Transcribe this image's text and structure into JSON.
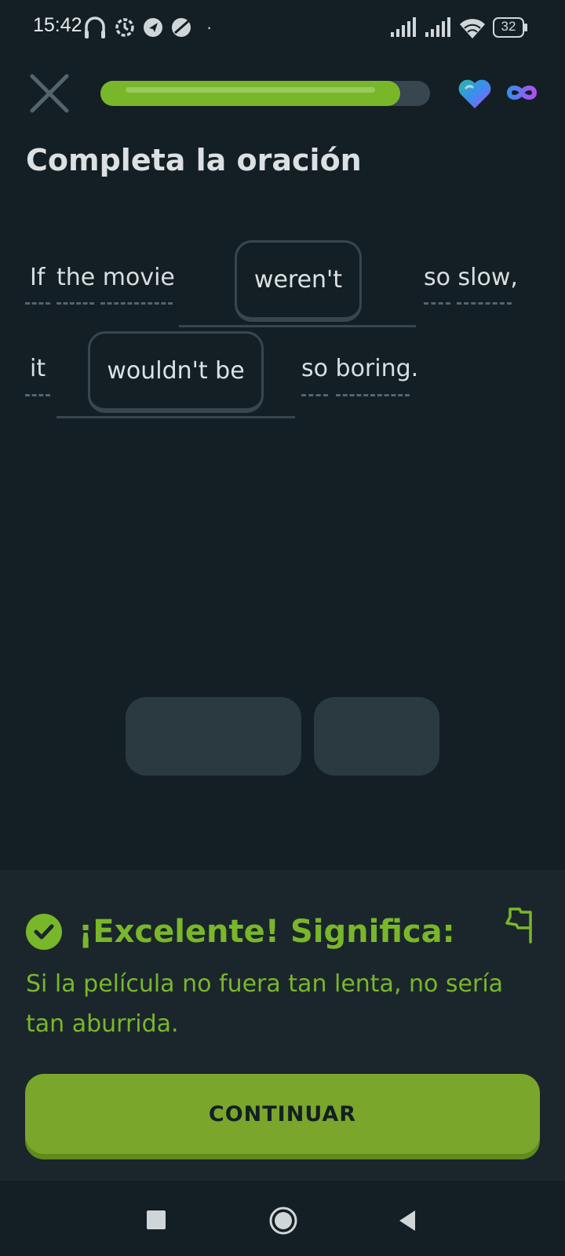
{
  "status_bar": {
    "time": "15:42",
    "dot": "·",
    "battery": "32",
    "icons": [
      "headphones-icon",
      "sync-icon",
      "airplane-icon",
      "app-icon",
      "signal-icon",
      "signal-icon",
      "wifi-icon",
      "battery-icon"
    ]
  },
  "header": {
    "progress": 0.91,
    "close_icon": "close-icon",
    "hearts_icon": "heart-icon",
    "hearts_value_icon": "infinity-icon"
  },
  "exercise": {
    "title": "Completa la oración",
    "line1": {
      "w_if": "If",
      "w_the_movie": "the movie",
      "answer1": "weren't",
      "w_so_slow": "so slow,"
    },
    "line2": {
      "w_it": "it",
      "answer2": "wouldn't be",
      "w_so_boring": "so boring."
    }
  },
  "feedback": {
    "title": "¡Excelente! Significa:",
    "translation": "Si la película no fuera tan lenta, no sería tan aburrida.",
    "continue_label": "CONTINUAR",
    "colors": {
      "accent": "#79b72a",
      "panel": "#1b262c",
      "background": "#131f24"
    }
  },
  "nav": {
    "icons": [
      "recents-square-icon",
      "home-circle-icon",
      "back-triangle-icon"
    ]
  }
}
